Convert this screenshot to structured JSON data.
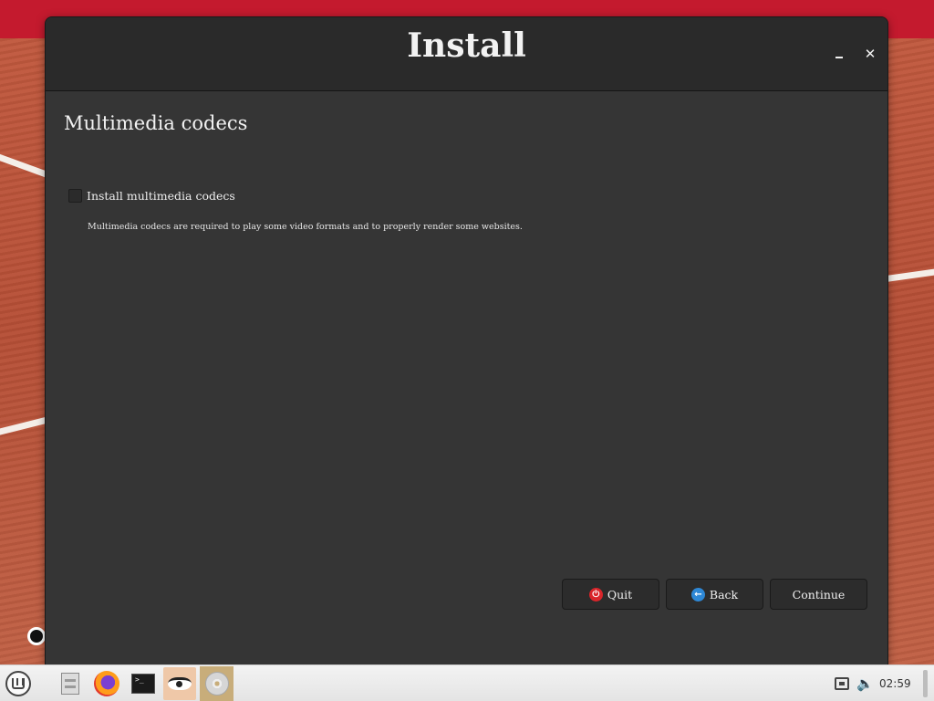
{
  "window": {
    "title": "Install",
    "minimize_icon": "minimize-icon",
    "close_symbol": "✕"
  },
  "page": {
    "heading": "Multimedia codecs",
    "option_label": "Install multimedia codecs",
    "option_checked": false,
    "description": "Multimedia codecs are required to play some video formats and to properly render some websites."
  },
  "buttons": {
    "quit": "Quit",
    "back": "Back",
    "continue": "Continue"
  },
  "taskbar": {
    "launchers": [
      "files-icon",
      "firefox-icon",
      "terminal-icon",
      "eyes-icon",
      "disc-icon"
    ],
    "terminal_prompt": ">_",
    "volume_symbol": "🔊",
    "clock": "02:59"
  },
  "colors": {
    "window_bg": "#353535",
    "titlebar_bg": "#2a2a2a",
    "quit_icon": "#d9252a",
    "back_icon": "#2e88d6",
    "desktop_band": "#c41a2e"
  }
}
